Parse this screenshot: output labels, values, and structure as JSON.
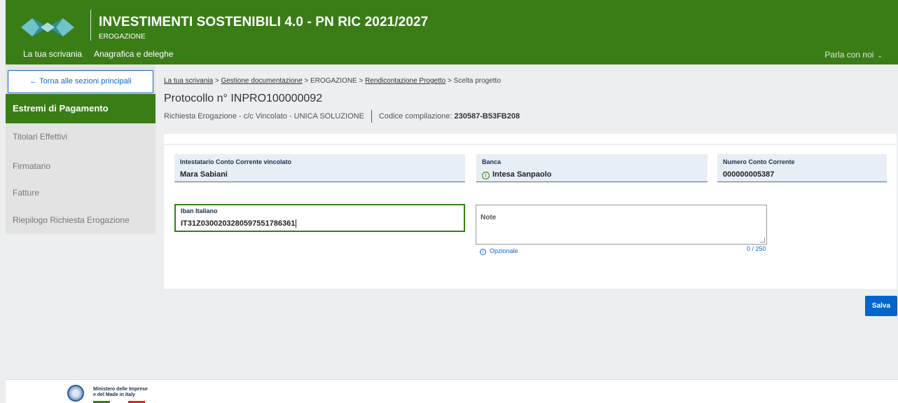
{
  "header": {
    "title": "INVESTIMENTI SOSTENIBILI 4.0 - PN RIC 2021/2027",
    "subtitle": "EROGAZIONE",
    "nav": [
      "La tua scrivania",
      "Anagrafica e deleghe"
    ],
    "contact": "Parla con noi"
  },
  "sidebar": {
    "back": "← Torna alle sezioni principali",
    "active": "Estremi di Pagamento",
    "items": [
      "Titolari Effettivi",
      "Firmatario",
      "Fatture",
      "Riepilogo Richiesta Erogazione"
    ]
  },
  "breadcrumb": {
    "items": [
      "La tua scrivania",
      "Gestione documentazione",
      "EROGAZIONE",
      "Rendicontazione Progetto",
      "Scelta progetto"
    ],
    "separator": ">"
  },
  "protocol": "Protocollo n° INPRO100000092",
  "request": {
    "type": "Richiesta Erogazione - c/c Vincolato  -  UNICA SOLUZIONE",
    "code_label": "Codice compilazione:",
    "code_value": "230587-B53FB208"
  },
  "fields": {
    "holder": {
      "label": "Intestatario Conto Corrente vincolato",
      "value": "Mara Sabiani"
    },
    "bank": {
      "label": "Banca",
      "value": "Intesa Sanpaolo"
    },
    "account": {
      "label": "Numero Conto Corrente",
      "value": "000000005387"
    },
    "iban": {
      "label": "Iban Italiano",
      "value": "IT31Z0300203280597551786361"
    },
    "note": {
      "label": "Note",
      "hint": "Opzionale",
      "counter": "0 / 250"
    }
  },
  "actions": {
    "save": "Salva"
  },
  "footer": {
    "ministry_line1": "Ministero delle Imprese",
    "ministry_line2": "e del Made in Italy"
  },
  "colors": {
    "primary_green": "#3a7d17",
    "primary_blue": "#0066cc",
    "field_bg": "#e7eef6"
  }
}
